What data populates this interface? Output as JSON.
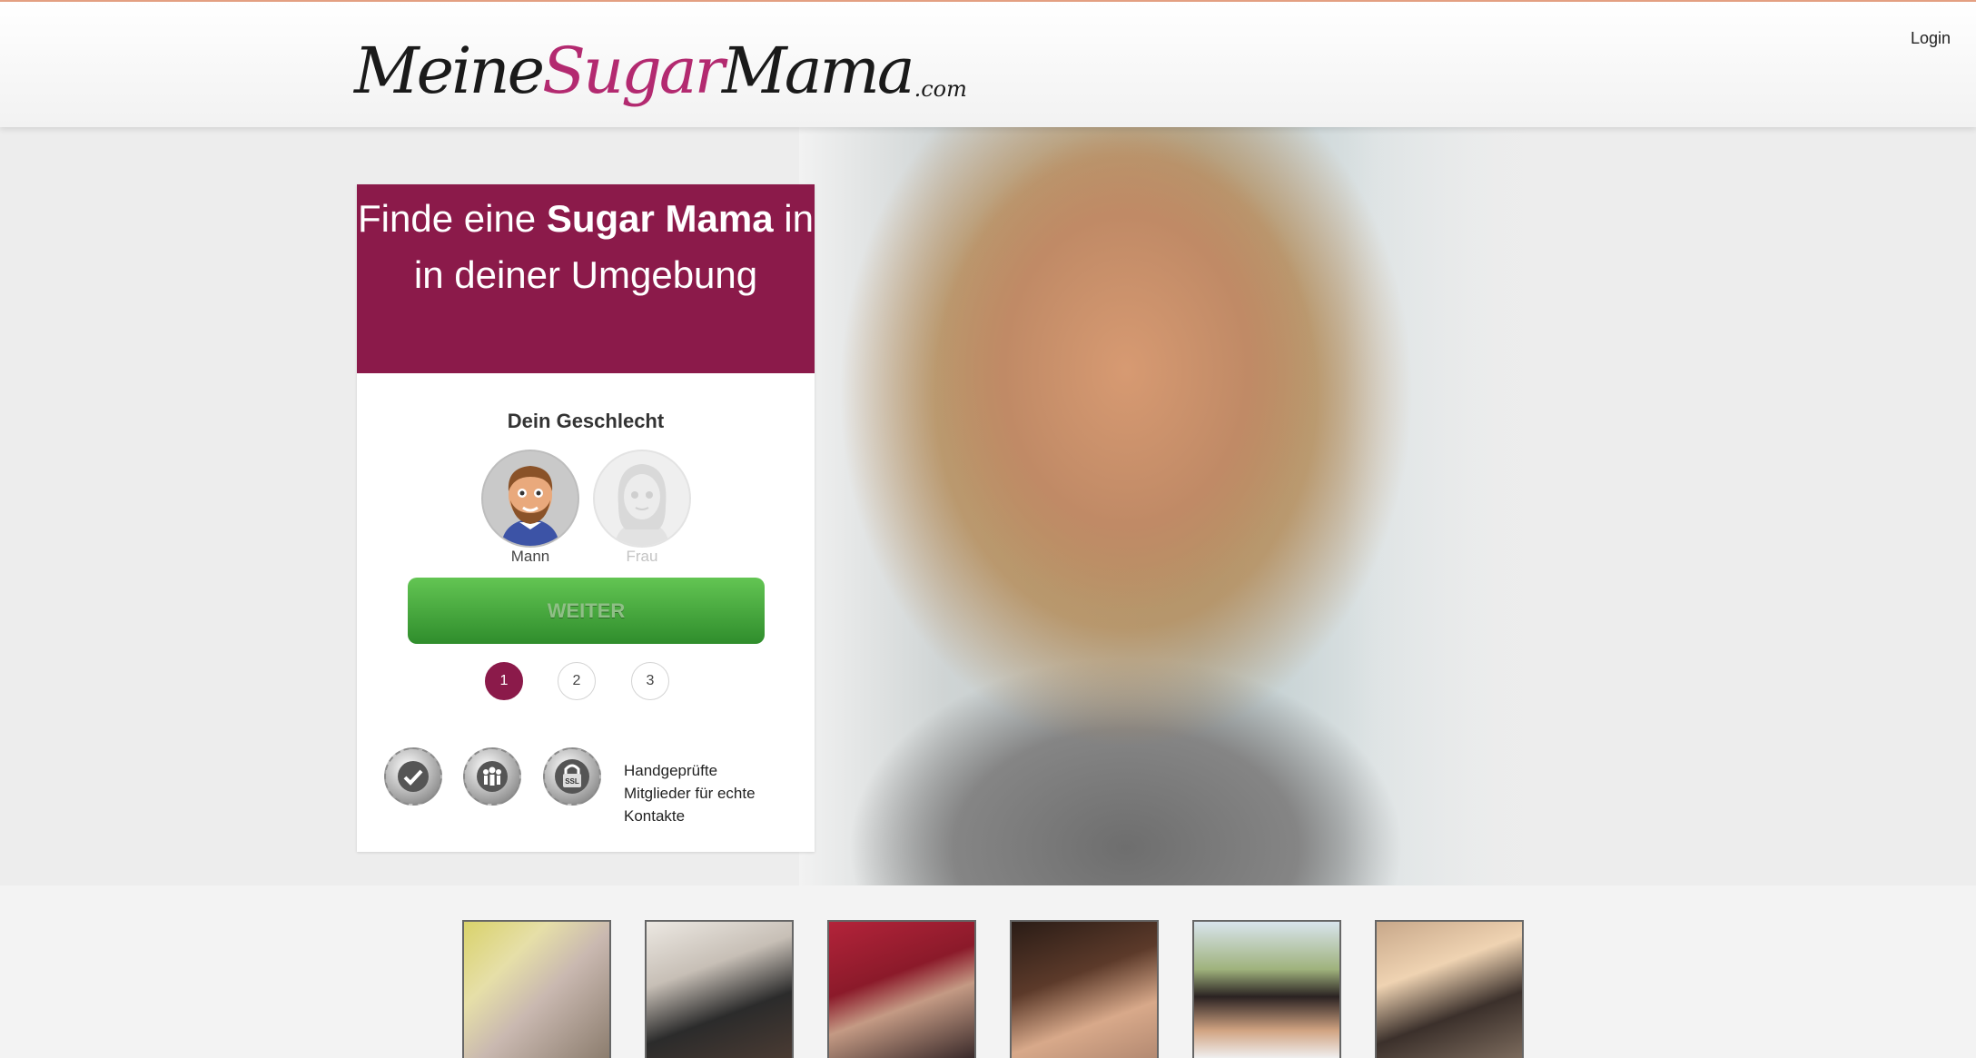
{
  "header": {
    "logo": {
      "part1": "Meine",
      "part2": "Sugar",
      "part3": "Mama",
      "suffix": ".com"
    },
    "login_label": "Login"
  },
  "signup": {
    "headline_pre": "Finde eine ",
    "headline_bold": "Sugar Mama",
    "headline_post": " in in deiner Umgebung",
    "gender_title": "Dein Geschlecht",
    "gender_options": [
      {
        "label": "Mann",
        "selected": true
      },
      {
        "label": "Frau",
        "selected": false
      }
    ],
    "continue_label": "WEITER",
    "steps": [
      "1",
      "2",
      "3"
    ],
    "active_step": 1,
    "trust_badges": [
      "checkmark-seal-icon",
      "members-seal-icon",
      "ssl-lock-seal-icon"
    ],
    "ssl_badge_text": "SSL",
    "trust_text": "Handgeprüfte Mitglieder für echte Kontakte"
  },
  "colors": {
    "brand": "#8b1a4a",
    "logo_accent": "#b32a70",
    "button_green": "#4caf43",
    "topline": "#e6a184"
  },
  "profile_thumbnails": 6
}
